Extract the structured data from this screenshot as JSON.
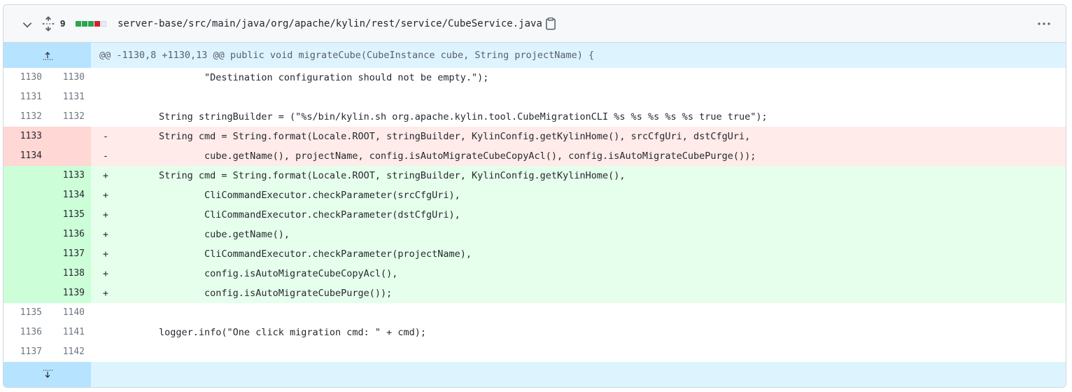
{
  "file": {
    "change_count": "9",
    "path": "server-base/src/main/java/org/apache/kylin/rest/service/CubeService.java",
    "diffstat": [
      "add",
      "add",
      "add",
      "del",
      "neutral"
    ],
    "colors": {
      "add": "#2da44e",
      "del": "#cf222e",
      "neutral": "#eaeef2"
    }
  },
  "hunk": {
    "header": "@@ -1130,8 +1130,13 @@ public void migrateCube(CubeInstance cube, String projectName) {"
  },
  "lines": [
    {
      "type": "ctx",
      "old": "1130",
      "new": "1130",
      "sign": " ",
      "code": "                \"Destination configuration should not be empty.\");"
    },
    {
      "type": "ctx",
      "old": "1131",
      "new": "1131",
      "sign": " ",
      "code": ""
    },
    {
      "type": "ctx",
      "old": "1132",
      "new": "1132",
      "sign": " ",
      "code": "        String stringBuilder = (\"%s/bin/kylin.sh org.apache.kylin.tool.CubeMigrationCLI %s %s %s %s %s true true\");"
    },
    {
      "type": "del",
      "old": "1133",
      "new": "",
      "sign": "-",
      "code": "        String cmd = String.format(Locale.ROOT, stringBuilder, KylinConfig.getKylinHome(), srcCfgUri, dstCfgUri,"
    },
    {
      "type": "del",
      "old": "1134",
      "new": "",
      "sign": "-",
      "code": "                cube.getName(), projectName, config.isAutoMigrateCubeCopyAcl(), config.isAutoMigrateCubePurge());"
    },
    {
      "type": "add",
      "old": "",
      "new": "1133",
      "sign": "+",
      "code": "        String cmd = String.format(Locale.ROOT, stringBuilder, KylinConfig.getKylinHome(),"
    },
    {
      "type": "add",
      "old": "",
      "new": "1134",
      "sign": "+",
      "code": "                CliCommandExecutor.checkParameter(srcCfgUri),"
    },
    {
      "type": "add",
      "old": "",
      "new": "1135",
      "sign": "+",
      "code": "                CliCommandExecutor.checkParameter(dstCfgUri),"
    },
    {
      "type": "add",
      "old": "",
      "new": "1136",
      "sign": "+",
      "code": "                cube.getName(),"
    },
    {
      "type": "add",
      "old": "",
      "new": "1137",
      "sign": "+",
      "code": "                CliCommandExecutor.checkParameter(projectName),"
    },
    {
      "type": "add",
      "old": "",
      "new": "1138",
      "sign": "+",
      "code": "                config.isAutoMigrateCubeCopyAcl(),"
    },
    {
      "type": "add",
      "old": "",
      "new": "1139",
      "sign": "+",
      "code": "                config.isAutoMigrateCubePurge());"
    },
    {
      "type": "ctx",
      "old": "1135",
      "new": "1140",
      "sign": " ",
      "code": ""
    },
    {
      "type": "ctx",
      "old": "1136",
      "new": "1141",
      "sign": " ",
      "code": "        logger.info(\"One click migration cmd: \" + cmd);"
    },
    {
      "type": "ctx",
      "old": "1137",
      "new": "1142",
      "sign": " ",
      "code": ""
    }
  ],
  "icons": {
    "collapse": "chevron-down-icon",
    "expand_all": "unfold-icon",
    "copy": "copy-icon",
    "more": "kebab-horizontal-icon",
    "expand_up": "expand-up-icon",
    "expand_down": "expand-down-icon"
  }
}
